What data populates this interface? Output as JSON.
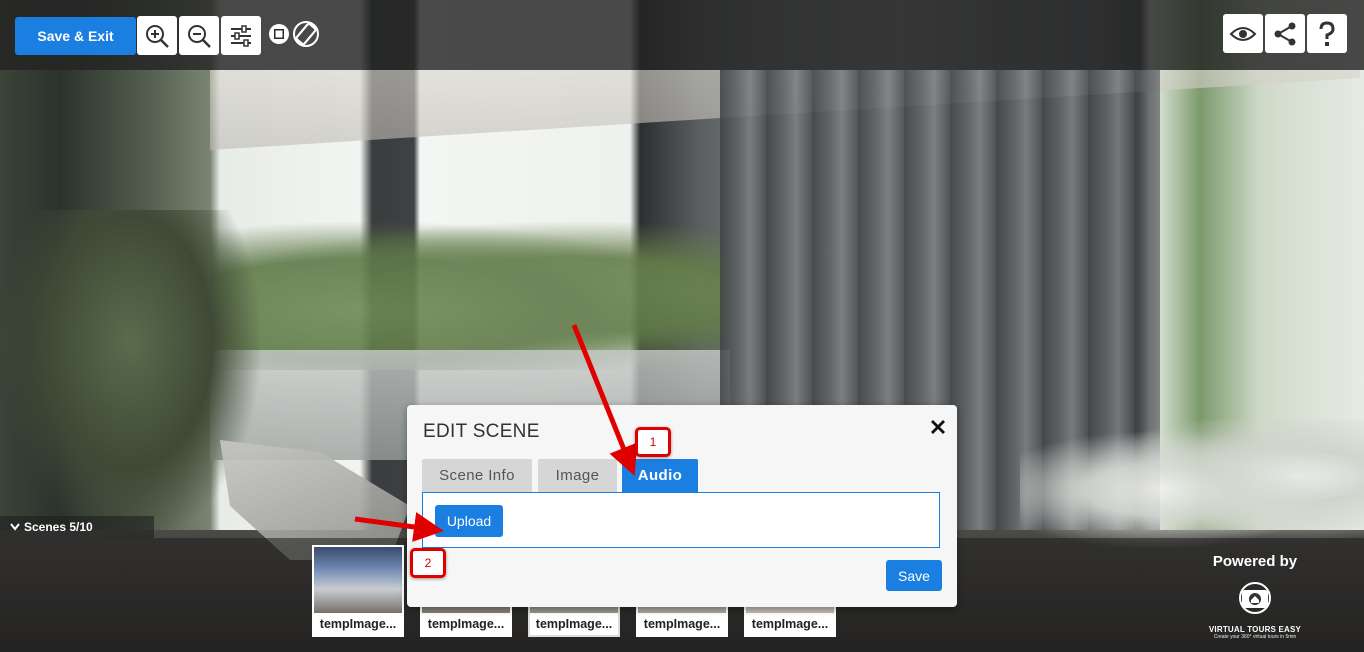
{
  "toolbar": {
    "save_exit_label": "Save & Exit",
    "icons": [
      "zoom-in-icon",
      "zoom-out-icon",
      "sliders-icon",
      "stop-icon",
      "rotate-icon",
      "eye-icon",
      "share-icon",
      "help-icon"
    ]
  },
  "scenes": {
    "label": "Scenes 5/10",
    "thumbnails": [
      {
        "caption": "tempImage..."
      },
      {
        "caption": "tempImage..."
      },
      {
        "caption": "tempImage..."
      },
      {
        "caption": "tempImage..."
      },
      {
        "caption": "tempImage..."
      }
    ]
  },
  "powered": {
    "label": "Powered by",
    "brand": "VIRTUAL TOURS EASY",
    "tagline": "Create your 360° virtual tours in 5min"
  },
  "modal": {
    "title": "EDIT SCENE",
    "tabs": [
      {
        "label": "Scene Info"
      },
      {
        "label": "Image"
      },
      {
        "label": "Audio"
      }
    ],
    "active_tab": "Audio",
    "upload_label": "Upload",
    "save_label": "Save"
  },
  "annotations": [
    {
      "label": "1"
    },
    {
      "label": "2"
    }
  ],
  "colors": {
    "accent": "#1a7fe0",
    "callout": "#e00000"
  }
}
